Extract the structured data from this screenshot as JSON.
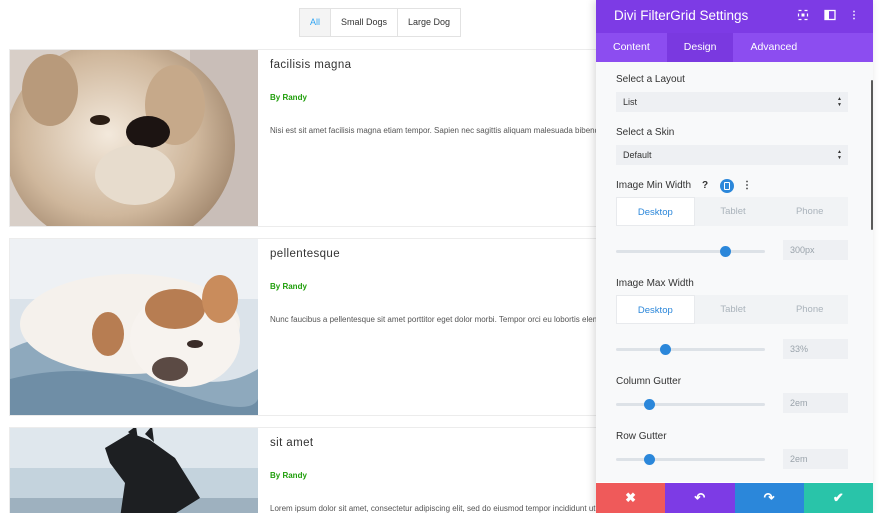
{
  "filters": [
    {
      "label": "All",
      "active": true
    },
    {
      "label": "Small Dogs",
      "active": false
    },
    {
      "label": "Large Dog",
      "active": false
    }
  ],
  "posts": [
    {
      "title": "facilisis magna",
      "author": "By Randy",
      "excerpt": "Nisi est sit amet facilisis magna etiam tempor. Sapien nec sagittis aliquam malesuada bibendum arcu vitae elementum."
    },
    {
      "title": "pellentesque",
      "author": "By Randy",
      "excerpt": "Nunc faucibus a pellentesque sit amet porttitor eget dolor morbi. Tempor orci eu lobortis elementum nibh tellus."
    },
    {
      "title": "sit amet",
      "author": "By Randy",
      "excerpt": "Lorem ipsum dolor sit amet, consectetur adipiscing elit, sed do eiusmod tempor incididunt ut labore et dolore magna"
    }
  ],
  "panel": {
    "title": "Divi FilterGrid Settings",
    "tabs": [
      "Content",
      "Design",
      "Advanced"
    ],
    "active_tab": "Design",
    "layout_label": "Select a Layout",
    "layout_value": "List",
    "skin_label": "Select a Skin",
    "skin_value": "Default",
    "min_width": {
      "label": "Image Min Width",
      "devices": [
        "Desktop",
        "Tablet",
        "Phone"
      ],
      "value": "300px",
      "slider_pct": 73
    },
    "max_width": {
      "label": "Image Max Width",
      "devices": [
        "Desktop",
        "Tablet",
        "Phone"
      ],
      "value": "33%",
      "slider_pct": 33
    },
    "column_gutter": {
      "label": "Column Gutter",
      "value": "2em",
      "slider_pct": 22
    },
    "row_gutter": {
      "label": "Row Gutter",
      "value": "2em",
      "slider_pct": 22
    }
  },
  "colors": {
    "header": "#7d3be5",
    "tabs": "#8c4df0",
    "accent": "#2b87da",
    "cancel": "#ef5a5a",
    "undo": "#7d3be5",
    "redo": "#2b87da",
    "save": "#29c4a9",
    "author": "#1f9e0a"
  },
  "icons": {
    "help": "?",
    "more": "⋮",
    "close": "✖",
    "undo": "↶",
    "redo": "↷",
    "check": "✔"
  }
}
